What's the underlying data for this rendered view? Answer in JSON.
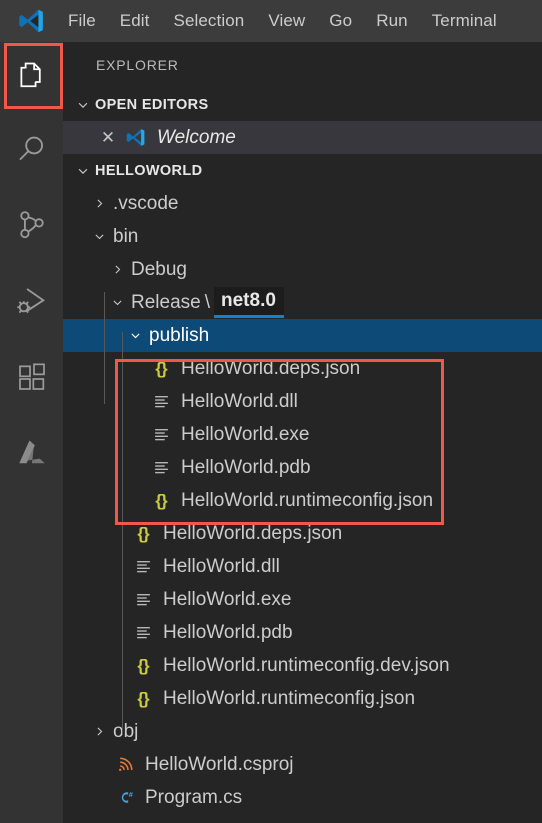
{
  "app": {
    "logo_name": "vscode-logo",
    "colors": {
      "titlebar_bg": "#3c3c3c",
      "activitybar_bg": "#333333",
      "sidebar_bg": "#252526",
      "selection_blue": "#0e4a78",
      "annotation_red": "#f2574b",
      "json_icon_yellow": "#cbcb41",
      "csharp_blue": "#4e9fd6",
      "csproj_orange": "#e37933",
      "open_editor_bg": "#37373d",
      "focus_underline_blue": "#0a84d8"
    }
  },
  "menubar": {
    "items": [
      {
        "label": "File"
      },
      {
        "label": "Edit"
      },
      {
        "label": "Selection"
      },
      {
        "label": "View"
      },
      {
        "label": "Go"
      },
      {
        "label": "Run"
      },
      {
        "label": "Terminal"
      }
    ]
  },
  "activitybar": {
    "items": [
      {
        "name": "explorer",
        "icon": "files-icon",
        "title": "Explorer",
        "active": true,
        "highlighted": true
      },
      {
        "name": "search",
        "icon": "search-icon",
        "title": "Search",
        "active": false,
        "highlighted": false
      },
      {
        "name": "source-control",
        "icon": "source-control-icon",
        "title": "Source Control",
        "active": false,
        "highlighted": false
      },
      {
        "name": "run-debug",
        "icon": "run-and-debug-icon",
        "title": "Run and Debug",
        "active": false,
        "highlighted": false
      },
      {
        "name": "extensions",
        "icon": "extensions-icon",
        "title": "Extensions",
        "active": false,
        "highlighted": false
      },
      {
        "name": "azure",
        "icon": "azure-icon",
        "title": "Azure",
        "active": false,
        "highlighted": false
      }
    ]
  },
  "sidebar": {
    "title": "EXPLORER",
    "open_editors": {
      "header": "OPEN EDITORS",
      "expanded": true,
      "items": [
        {
          "label": "Welcome",
          "icon": "vscode-logo-icon",
          "close_glyph": "✕",
          "active": true
        }
      ]
    },
    "workspace": {
      "header": "HELLOWORLD",
      "expanded": true,
      "tree": [
        {
          "label": ".vscode",
          "type": "folder",
          "expanded": false,
          "indent": 1
        },
        {
          "label": "bin",
          "type": "folder",
          "expanded": true,
          "indent": 1
        },
        {
          "label": "Debug",
          "type": "folder",
          "expanded": false,
          "indent": 2
        },
        {
          "label": "Release",
          "type": "folder",
          "expanded": true,
          "indent": 2,
          "compact_separator": "\\",
          "compact_segment": "net8.0",
          "segment_focused": true
        },
        {
          "label": "publish",
          "type": "folder",
          "expanded": true,
          "indent": 3,
          "selected": true
        },
        {
          "label": "HelloWorld.deps.json",
          "type": "json",
          "indent": 4,
          "boxed": true
        },
        {
          "label": "HelloWorld.dll",
          "type": "binary",
          "indent": 4,
          "boxed": true
        },
        {
          "label": "HelloWorld.exe",
          "type": "binary",
          "indent": 4,
          "boxed": true
        },
        {
          "label": "HelloWorld.pdb",
          "type": "binary",
          "indent": 4,
          "boxed": true
        },
        {
          "label": "HelloWorld.runtimeconfig.json",
          "type": "json",
          "indent": 4,
          "boxed": true
        },
        {
          "label": "HelloWorld.deps.json",
          "type": "json",
          "indent": 3
        },
        {
          "label": "HelloWorld.dll",
          "type": "binary",
          "indent": 3
        },
        {
          "label": "HelloWorld.exe",
          "type": "binary",
          "indent": 3
        },
        {
          "label": "HelloWorld.pdb",
          "type": "binary",
          "indent": 3
        },
        {
          "label": "HelloWorld.runtimeconfig.dev.json",
          "type": "json",
          "indent": 3
        },
        {
          "label": "HelloWorld.runtimeconfig.json",
          "type": "json",
          "indent": 3
        },
        {
          "label": "obj",
          "type": "folder",
          "expanded": false,
          "indent": 1
        },
        {
          "label": "HelloWorld.csproj",
          "type": "csproj",
          "indent": 1
        },
        {
          "label": "Program.cs",
          "type": "csharp",
          "indent": 1
        }
      ]
    }
  },
  "icons": {
    "json_glyph": "{}",
    "csharp_glyph": "C#",
    "chevron_right": "›",
    "chevron_down": "⌄"
  },
  "annotations": [
    {
      "name": "explorer-icon-highlight",
      "target": "activitybar.explorer"
    },
    {
      "name": "publish-files-highlight",
      "target": "sidebar.workspace.publish.children"
    }
  ]
}
